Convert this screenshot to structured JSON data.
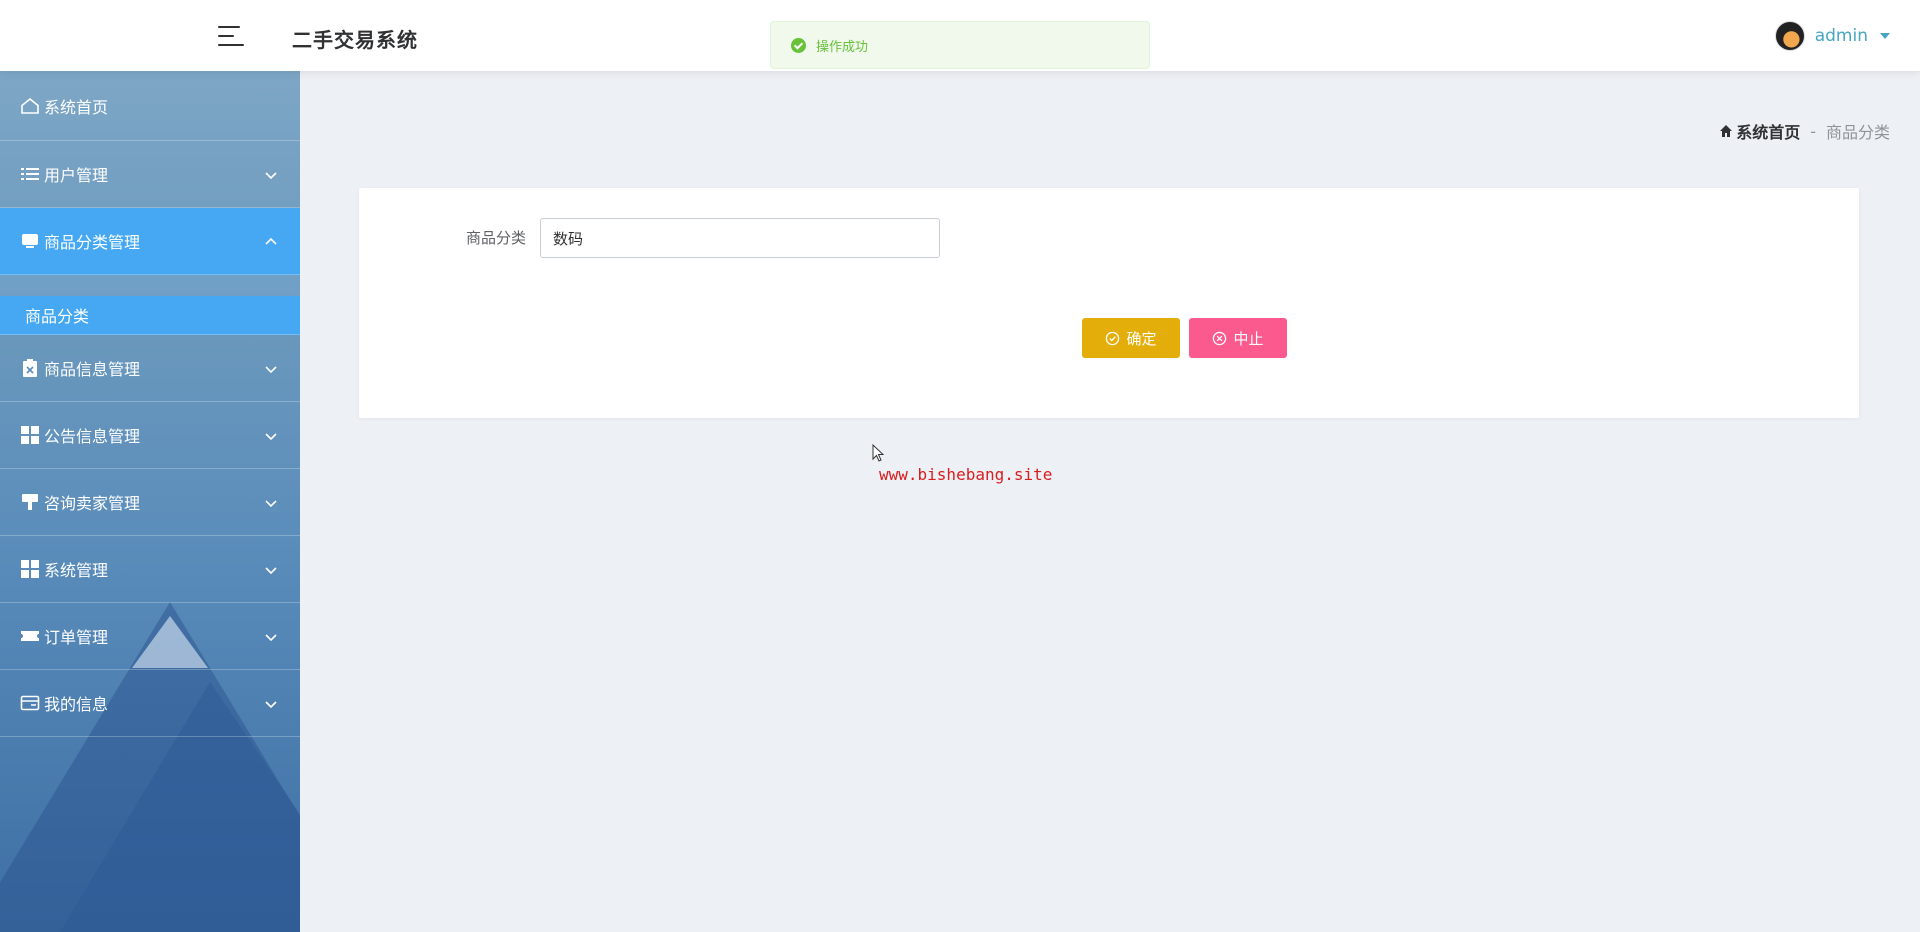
{
  "header": {
    "app_title": "二手交易系统",
    "username": "admin"
  },
  "toast": {
    "message": "操作成功",
    "type": "success"
  },
  "sidebar": {
    "items": [
      {
        "label": "系统首页",
        "icon": "home-icon"
      },
      {
        "label": "用户管理",
        "icon": "list-icon"
      },
      {
        "label": "商品分类管理",
        "icon": "tray-icon",
        "expanded": true,
        "children": [
          {
            "label": "商品分类",
            "active": true
          }
        ]
      },
      {
        "label": "商品信息管理",
        "icon": "clipboard-icon"
      },
      {
        "label": "公告信息管理",
        "icon": "grid-icon"
      },
      {
        "label": "咨询卖家管理",
        "icon": "brush-icon"
      },
      {
        "label": "系统管理",
        "icon": "grid-icon"
      },
      {
        "label": "订单管理",
        "icon": "ticket-icon"
      },
      {
        "label": "我的信息",
        "icon": "card-icon"
      }
    ]
  },
  "breadcrumb": {
    "home": "系统首页",
    "separator": "-",
    "current": "商品分类"
  },
  "form": {
    "field_label": "商品分类",
    "field_value": "数码",
    "confirm_label": "确定",
    "cancel_label": "中止"
  },
  "watermark": "www.bishebang.site",
  "colors": {
    "accent": "#46a8f2",
    "confirm": "#e3ae0a",
    "cancel": "#fb5a8f",
    "success": "#67c23a"
  }
}
